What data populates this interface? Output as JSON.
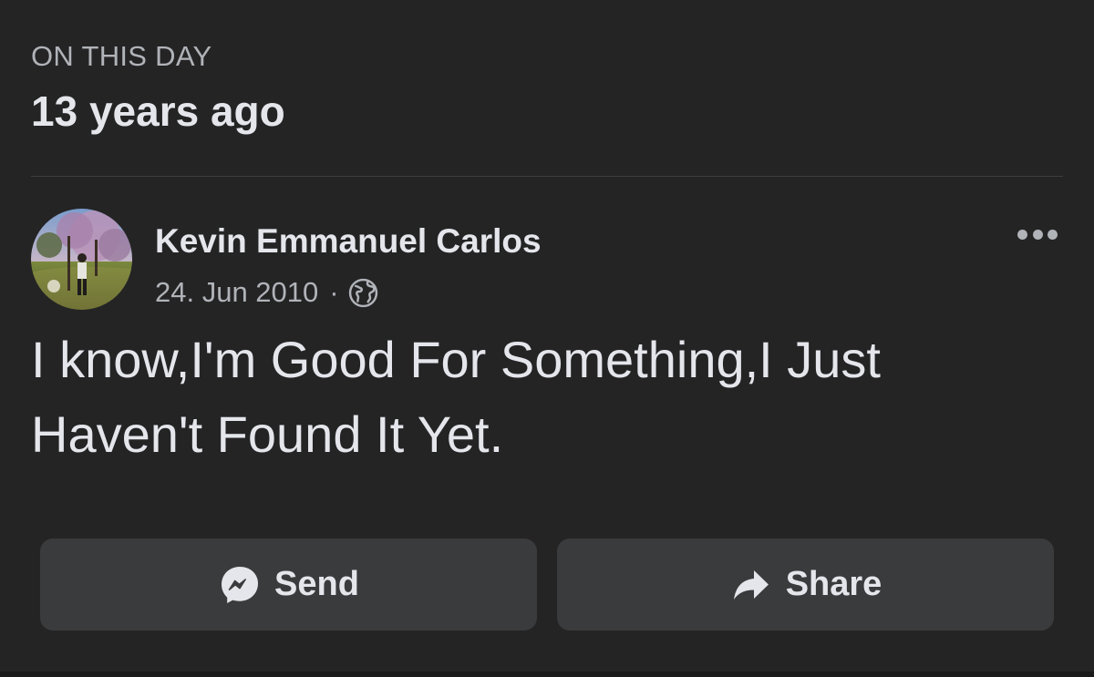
{
  "memory": {
    "eyebrow": "ON THIS DAY",
    "headline": "13 years ago"
  },
  "post": {
    "author": "Kevin Emmanuel Carlos",
    "date": "24. Jun 2010",
    "separator": "·",
    "privacy_icon": "globe-icon",
    "menu_icon": "more-options-icon",
    "text_line_1": "I know,I'm Good For Something,I Just",
    "text_line_2": "Haven't Found It Yet."
  },
  "actions": {
    "send_label": "Send",
    "send_icon": "messenger-icon",
    "share_label": "Share",
    "share_icon": "share-arrow-icon"
  },
  "colors": {
    "background": "#242425",
    "button": "#3a3b3c",
    "primary_text": "#e4e6eb",
    "secondary_text": "#b0b3b8"
  }
}
